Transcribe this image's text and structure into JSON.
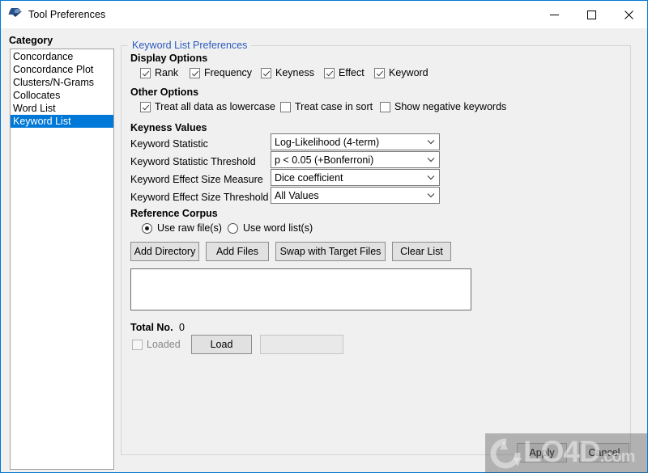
{
  "window": {
    "title": "Tool Preferences",
    "icon": "antconc-app-icon",
    "accent_color": "#0078d7",
    "background_color": "#f0f0f0",
    "controls": [
      {
        "name": "minimize",
        "glyph": "─"
      },
      {
        "name": "maximize",
        "glyph": "□"
      },
      {
        "name": "close",
        "glyph": "✕"
      }
    ]
  },
  "sidebar": {
    "label": "Category",
    "items": [
      {
        "label": "Concordance",
        "selected": false
      },
      {
        "label": "Concordance Plot",
        "selected": false
      },
      {
        "label": "Clusters/N-Grams",
        "selected": false
      },
      {
        "label": "Collocates",
        "selected": false
      },
      {
        "label": "Word List",
        "selected": false
      },
      {
        "label": "Keyword List",
        "selected": true
      }
    ],
    "selection_color": "#0078d7"
  },
  "panel": {
    "title": "Keyword List Preferences",
    "title_color": "#2b5bbd",
    "display_options": {
      "heading": "Display Options",
      "checkboxes": [
        {
          "label": "Rank",
          "checked": true
        },
        {
          "label": "Frequency",
          "checked": true
        },
        {
          "label": "Keyness",
          "checked": true
        },
        {
          "label": "Effect",
          "checked": true
        },
        {
          "label": "Keyword",
          "checked": true
        }
      ]
    },
    "other_options": {
      "heading": "Other Options",
      "checkboxes": [
        {
          "label": "Treat all data as lowercase",
          "checked": true
        },
        {
          "label": "Treat case in sort",
          "checked": false
        },
        {
          "label": "Show negative keywords",
          "checked": false
        }
      ]
    },
    "keyness_values": {
      "heading": "Keyness Values",
      "rows": [
        {
          "label": "Keyword Statistic",
          "value": "Log-Likelihood (4-term)"
        },
        {
          "label": "Keyword Statistic Threshold",
          "value": "p < 0.05 (+Bonferroni)"
        },
        {
          "label": "Keyword Effect Size Measure",
          "value": "Dice coefficient"
        },
        {
          "label": "Keyword Effect Size Threshold",
          "value": "All Values"
        }
      ]
    },
    "reference_corpus": {
      "heading": "Reference Corpus",
      "radios": [
        {
          "label": "Use raw file(s)",
          "selected": true
        },
        {
          "label": "Use word list(s)",
          "selected": false
        }
      ],
      "buttons": [
        {
          "label": "Add Directory"
        },
        {
          "label": "Add Files"
        },
        {
          "label": "Swap with Target Files"
        },
        {
          "label": "Clear List"
        }
      ],
      "file_list_value": "",
      "total_label": "Total No.",
      "total_value": "0",
      "loaded_checkbox": {
        "label": "Loaded",
        "checked": false,
        "disabled": true
      },
      "load_button": {
        "label": "Load",
        "disabled": false
      },
      "status_field": {
        "value": "",
        "disabled": true
      }
    }
  },
  "footer": {
    "apply_label": "Apply",
    "cancel_label": "Cancel"
  },
  "watermark": {
    "text_main": "LO4D",
    "text_suffix": ".com",
    "logo": "circular-arrows-icon"
  }
}
